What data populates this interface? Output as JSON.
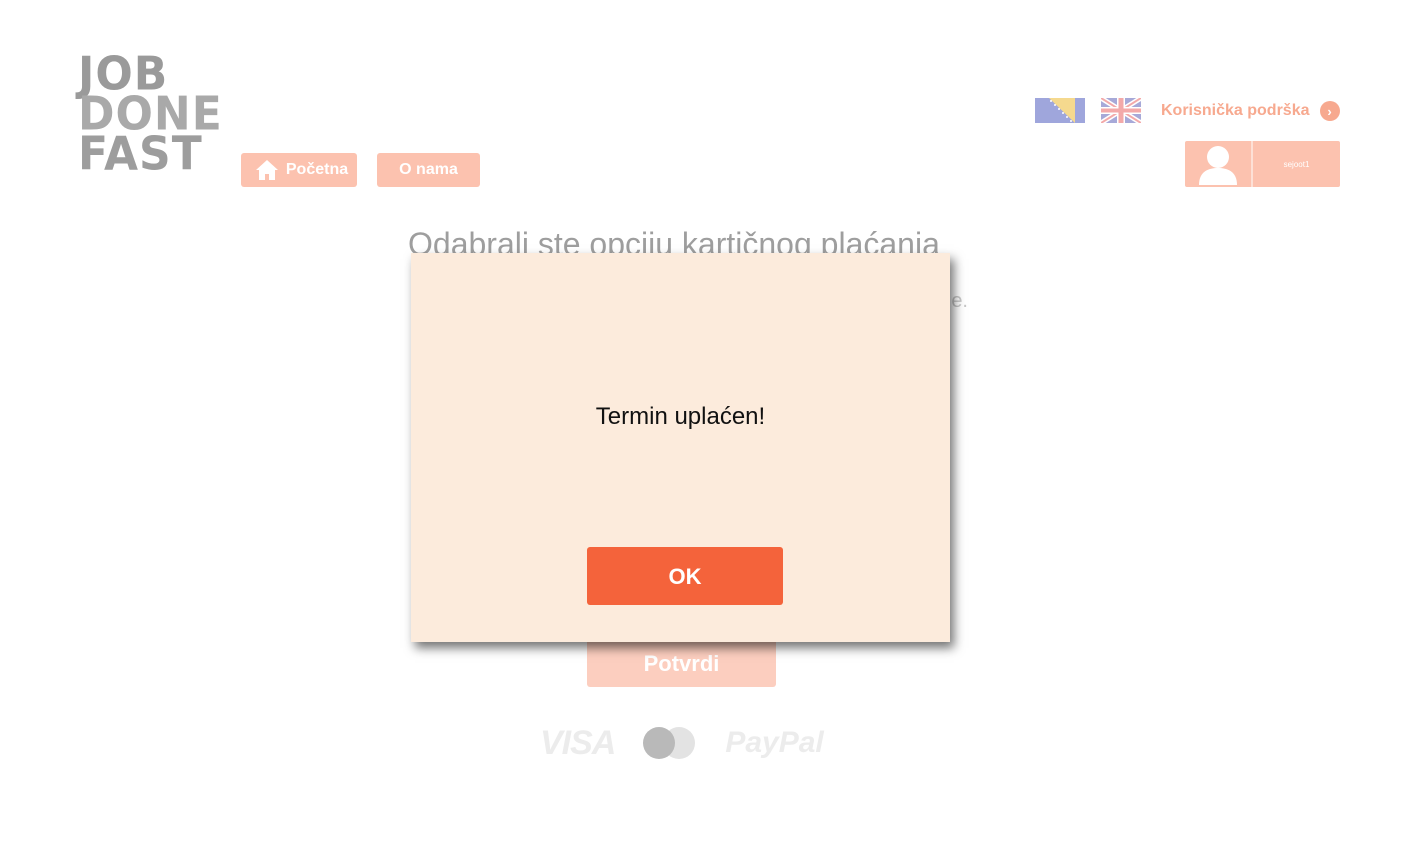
{
  "logo": {
    "line1": "JOB",
    "line2": "DONE",
    "line3": "FAST"
  },
  "nav": {
    "home_label": "Početna",
    "about_label": "O nama"
  },
  "header": {
    "support_label": "Korisnička podrška",
    "user_label": "sejoot1"
  },
  "background": {
    "heading": "Odabrali ste opciju kartičnog plaćanja",
    "subtext_tail": "e.",
    "confirm_label": "Potvrdi",
    "payment_logos": {
      "visa": "VISA",
      "paypal": "PayPal"
    }
  },
  "modal": {
    "message": "Termin uplaćen!",
    "ok_label": "OK"
  },
  "colors": {
    "accent": "#f4633b",
    "accent_faded": "#fcc2af",
    "modal_bg": "#fcebdc"
  }
}
